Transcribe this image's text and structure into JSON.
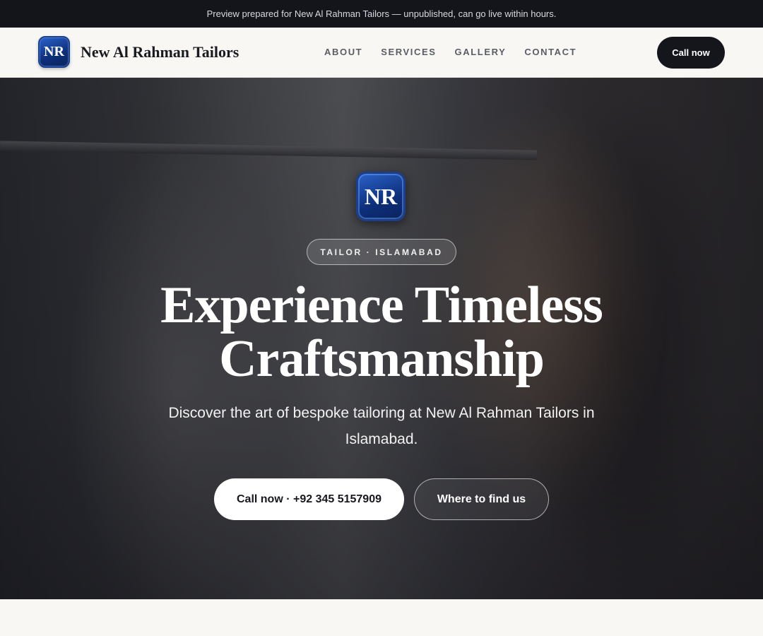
{
  "preview_bar": {
    "text": "Preview prepared for New Al Rahman Tailors — unpublished, can go live within hours."
  },
  "header": {
    "logo_text": "NR",
    "brand_name": "New Al Rahman Tailors",
    "nav": [
      "ABOUT",
      "SERVICES",
      "GALLERY",
      "CONTACT"
    ],
    "cta_label": "Call now"
  },
  "hero": {
    "logo_text": "NR",
    "tag": "TAILOR · ISLAMABAD",
    "title": "Experience Timeless Craftsmanship",
    "subtitle": "Discover the art of bespoke tailoring at New Al Rahman Tailors in Islamabad.",
    "primary_button": "Call now · +92 345 5157909",
    "secondary_button": "Where to find us"
  },
  "colors": {
    "accent_blue": "#0d2f7a",
    "dark": "#14161c",
    "background": "#f8f7f4"
  }
}
